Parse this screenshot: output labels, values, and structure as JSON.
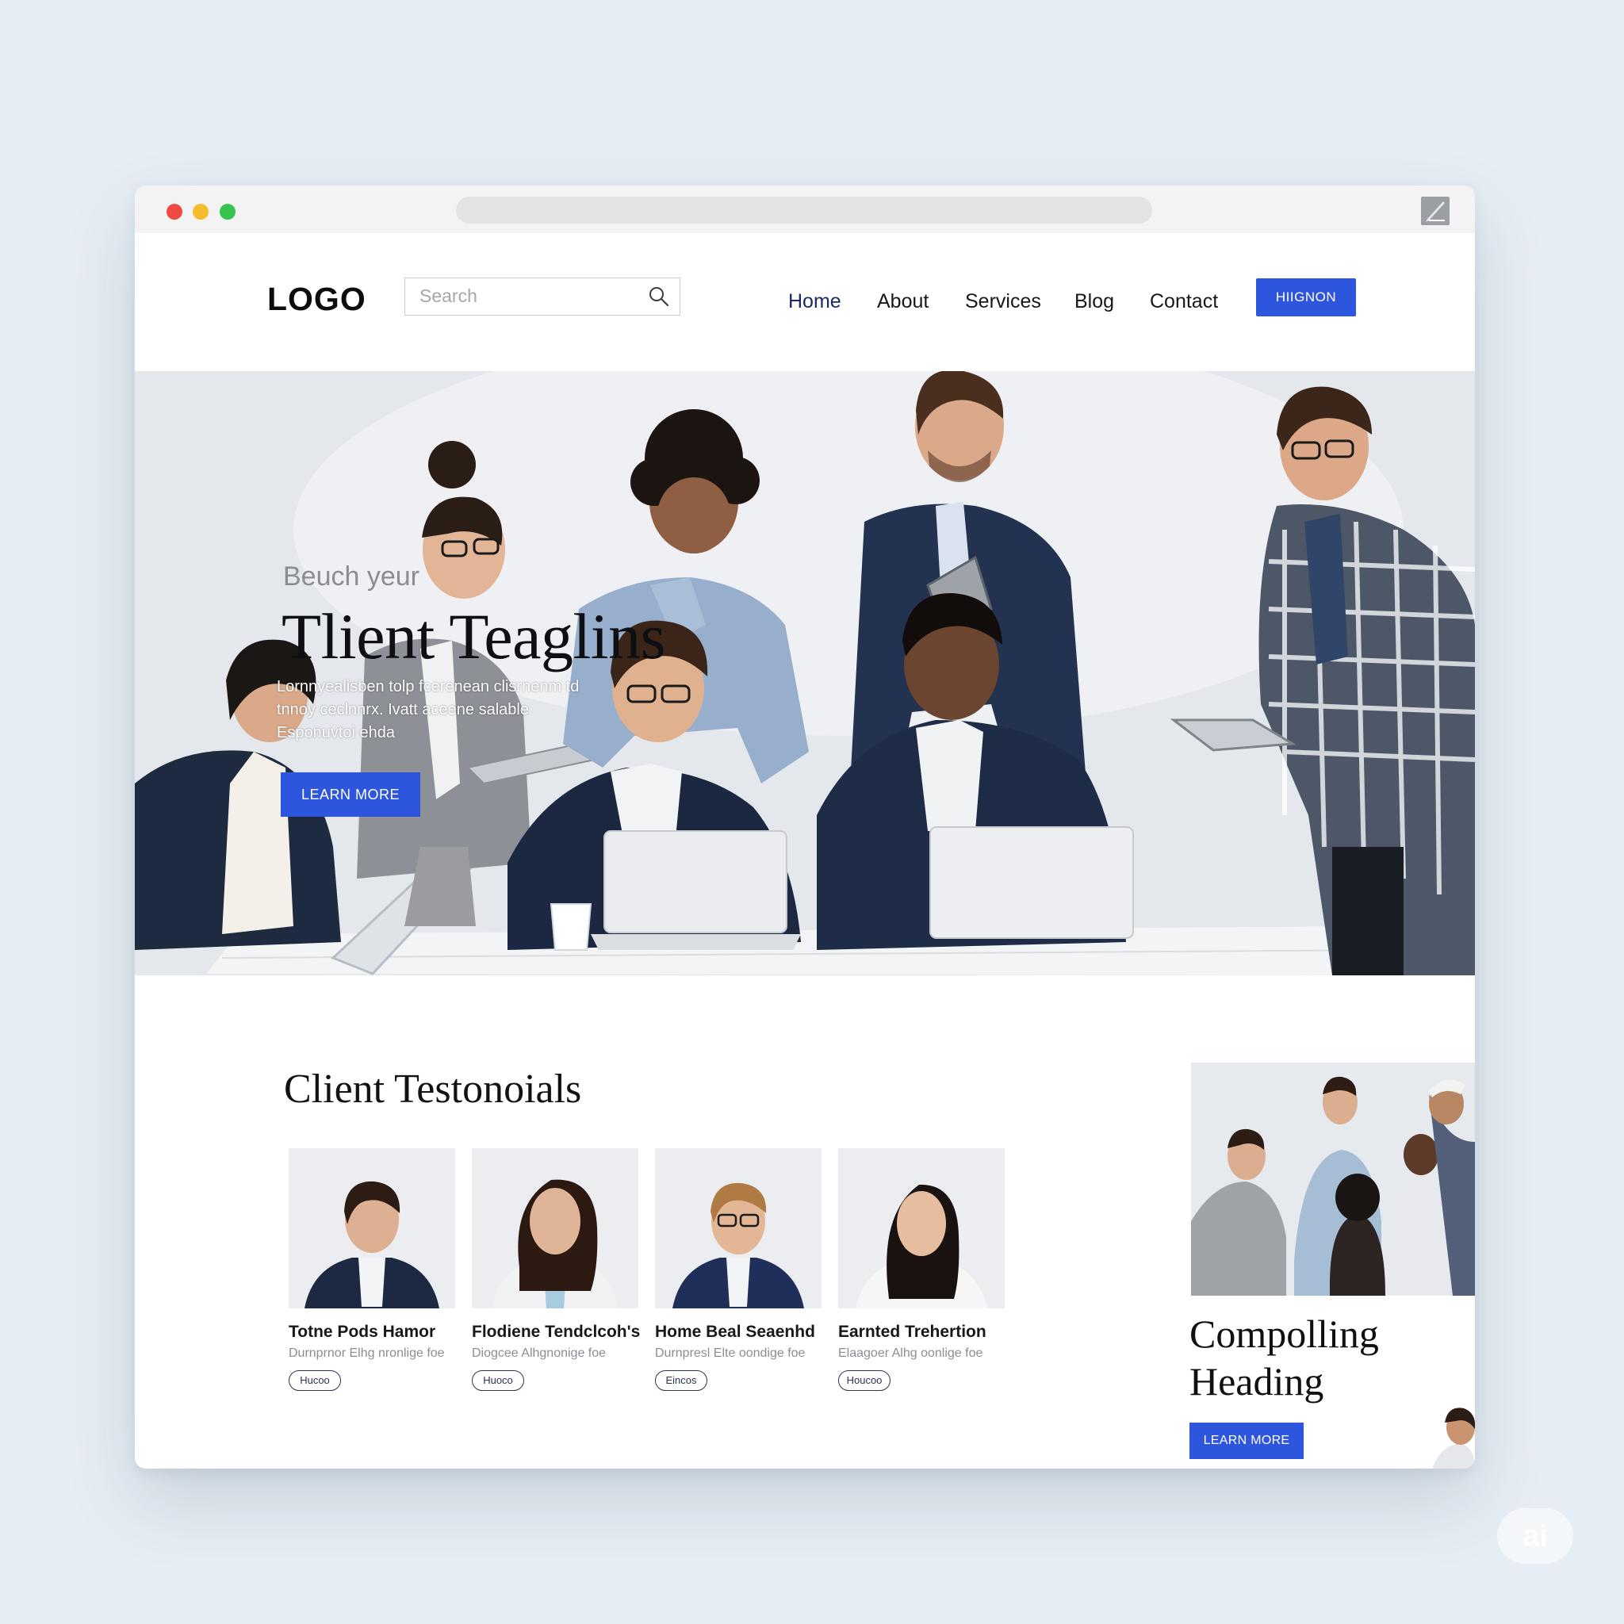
{
  "browser": {
    "window_controls": [
      "close",
      "minimize",
      "maximize"
    ],
    "extension_icon": "pencil-icon"
  },
  "header": {
    "logo": "LOGO",
    "search_placeholder": "Search",
    "nav": [
      {
        "label": "Home",
        "active": true
      },
      {
        "label": "About",
        "active": false
      },
      {
        "label": "Services",
        "active": false
      },
      {
        "label": "Blog",
        "active": false
      },
      {
        "label": "Contact",
        "active": false
      }
    ],
    "cta_label": "HIIGNON"
  },
  "hero": {
    "eyebrow": "Beuch yeur",
    "title": "Tlient Teaglins",
    "body": "Lornnyealisben tolp fcerenean clisrnenm td tnnoy ceclnnrx. Ivatt aceene salable Esponuvtoi ehda",
    "button_label": "LEARN MORE"
  },
  "testimonials": {
    "title": "Client Testonoials",
    "cards": [
      {
        "name": "Totne Pods Hamor",
        "desc": "Durnprnor Elhg nronlige foe",
        "tag": "Hucoo"
      },
      {
        "name": "Flodiene Tendclcoh's",
        "desc": "Diogcee Alhgnonige foe",
        "tag": "Huoco"
      },
      {
        "name": "Home Beal Seaenhd",
        "desc": "Durnpresl Elte oondige foe",
        "tag": "Eincos"
      },
      {
        "name": "Earnted Trehertion",
        "desc": "Elaagoer Alhg oonlige foe",
        "tag": "Houcoo"
      }
    ]
  },
  "feature": {
    "title_line1": "Compolling",
    "title_line2": "Heading",
    "button_label": "LEARN MORE"
  },
  "watermark": "ai",
  "colors": {
    "accent": "#2e55de",
    "nav_active": "#1b2a63",
    "page_bg": "#e7edf4"
  }
}
